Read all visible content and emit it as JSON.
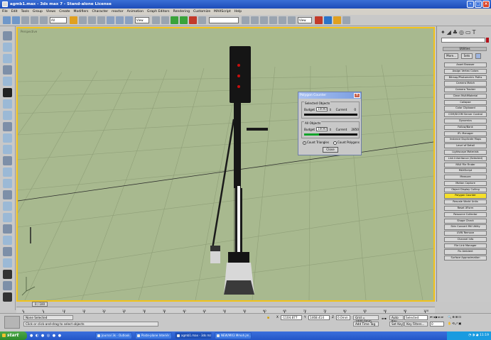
{
  "window": {
    "title": "agmb1.max - 3ds max 7 - Stand-alone License",
    "controls": [
      "minimize",
      "maximize",
      "close"
    ]
  },
  "menu": [
    "File",
    "Edit",
    "Tools",
    "Group",
    "Views",
    "Create",
    "Modifiers",
    "Character",
    "reactor",
    "Animation",
    "Graph Editors",
    "Rendering",
    "Customize",
    "MAXScript",
    "Help"
  ],
  "toolbar": {
    "selection_filter": "All",
    "reference_coord": "View",
    "named_selection": "",
    "render_type": "View",
    "accent_icon_colors": [
      "#2a73c9",
      "#e0a020",
      "#3aa33a",
      "#c23a2a"
    ]
  },
  "viewport": {
    "label": "Perspective",
    "axis_labels": [
      "x",
      "y",
      "z"
    ]
  },
  "polygon_counter": {
    "title": "Polygon Counter",
    "selected_objects": {
      "group_label": "Selected Objects",
      "budget_label": "Budget",
      "budget_value": "10000",
      "current_label": "Current",
      "current_value": "0",
      "fill_fraction": 0.0
    },
    "all_objects": {
      "group_label": "All Objects",
      "budget_label": "Budget",
      "budget_value": "10000",
      "current_label": "Current",
      "current_value": "2850",
      "fill_fraction": 0.28
    },
    "count_triangles_label": "Count Triangles",
    "count_polygons_label": "Count Polygons",
    "selected_mode": "triangles",
    "close_label": "Close"
  },
  "command_panel": {
    "tabs": [
      "create-icon",
      "modify-icon",
      "hierarchy-icon",
      "motion-icon",
      "display-icon",
      "utilities-icon"
    ],
    "rollout_title": "Utilities",
    "more_label": "More...",
    "sets_label": "Sets",
    "utilities": [
      "Asset Browser",
      "Assign Vertex Colors",
      "Bitmap/Photometric Paths",
      "Camera Match",
      "Camera Tracker",
      "Clean MultiMaterial",
      "Collapse",
      "Color Clipboard",
      "COM/DCOM Server Control",
      "Dynamics",
      "Follow/Bank",
      "IFL Manager",
      "Instance Duplicate Maps",
      "Level of Detail",
      "Lightscape Materials",
      "Link Inheritance (Selected)",
      "MAX File Finder",
      "MAXScript",
      "Measure",
      "Motion Capture",
      "Object Display Culling",
      "Polygon Counter",
      "Rescale World Units",
      "Reset XForm",
      "Resource Collector",
      "Shape Check",
      "Skin Convert Mtl Utility",
      "UVW Remove",
      "Channel Info",
      "File Link Manager",
      "Fix Ambient",
      "Surface Approximation"
    ],
    "active_utility": "Polygon Counter"
  },
  "timeline": {
    "slider_label": "0 / 100",
    "ticks": [
      "0",
      "5",
      "10",
      "15",
      "20",
      "25",
      "30",
      "35",
      "40",
      "45",
      "50",
      "55",
      "60",
      "65",
      "70",
      "75",
      "80",
      "85",
      "90",
      "95",
      "100"
    ]
  },
  "status": {
    "selection": "None Selected",
    "prompt": "Click or click-and-drag to select objects",
    "x_label": "X",
    "x_value": "-1104.877",
    "y_label": "Y",
    "y_value": "1468.414",
    "z_label": "Z",
    "z_value": "0.0mm",
    "grid": "Grid = 1000.0mm",
    "add_time_tag": "Add Time Tag",
    "auto_key": "Auto Key",
    "auto_key_value": "Selected",
    "set_key": "Set Key",
    "key_filters": "Key Filters...",
    "frame_value": "0"
  },
  "taskbar": {
    "start_label": "start",
    "tasks": [
      "Journal 3k - Outlook ...",
      "Poste-plane Interiér ...",
      "agmb1.max - 3ds ma...",
      "NEW/MX3 Mmoh.jm..."
    ],
    "clock": "11:19"
  }
}
